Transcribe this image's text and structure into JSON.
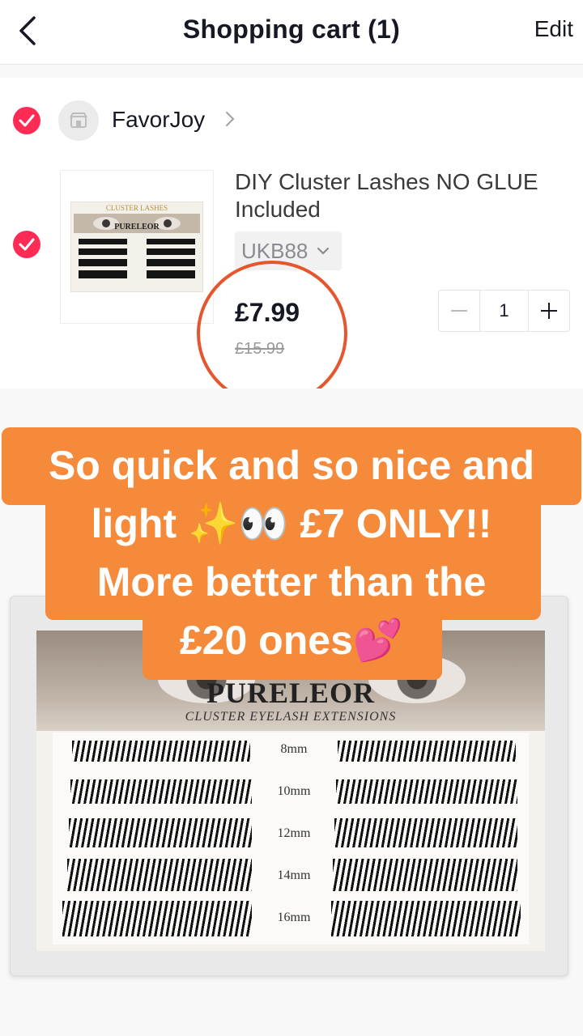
{
  "header": {
    "title": "Shopping cart (1)",
    "edit_label": "Edit"
  },
  "store": {
    "name": "FavorJoy"
  },
  "product": {
    "title": "DIY Cluster Lashes NO GLUE Included",
    "thumb_label": "CLUSTER LASHES",
    "thumb_brand": "PURELEOR",
    "variant": "UKB88",
    "price": "£7.99",
    "original_price": "£15.99",
    "quantity": "1"
  },
  "caption": {
    "line1": "So quick and so nice and",
    "line2": "light ✨👀 £7 ONLY!!",
    "line3": "More better than the",
    "line4": "£20 ones💕"
  },
  "photo": {
    "brand": "PURELEOR",
    "subtitle": "CLUSTER EYELASH EXTENSIONS",
    "sizes": [
      "8mm",
      "10mm",
      "12mm",
      "14mm",
      "16mm"
    ]
  },
  "colors": {
    "accent": "#fe2c55",
    "caption_bg": "#f48a3a",
    "annotation_circle": "#e4572e"
  }
}
